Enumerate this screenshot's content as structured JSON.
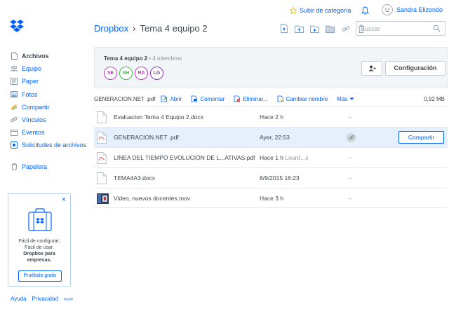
{
  "topbar": {
    "upgrade_label": "Subir de categoría",
    "user_name": "Sandra Elizondo"
  },
  "breadcrumb": {
    "root": "Dropbox",
    "separator": "›",
    "current": "Tema 4 equipo 2"
  },
  "search": {
    "placeholder": "Buscar"
  },
  "sidebar": {
    "items": [
      {
        "label": "Archivos",
        "icon": "files-icon"
      },
      {
        "label": "Equipo",
        "icon": "team-icon"
      },
      {
        "label": "Paper",
        "icon": "paper-icon"
      },
      {
        "label": "Fotos",
        "icon": "photos-icon"
      },
      {
        "label": "Compartir",
        "icon": "share-icon"
      },
      {
        "label": "Vínculos",
        "icon": "link-icon"
      },
      {
        "label": "Eventos",
        "icon": "events-icon"
      },
      {
        "label": "Solicitudes de archivos",
        "icon": "file-request-icon"
      }
    ],
    "trash_label": "Papelera"
  },
  "promo": {
    "line1": "Fácil de configurar.",
    "line2": "Fácil de usar.",
    "line3": "Dropbox para",
    "line4": "empresas.",
    "button": "Pruébalo gratis"
  },
  "footer": {
    "help": "Ayuda",
    "privacy": "Privacidad",
    "more": "«»»"
  },
  "share_panel": {
    "folder_name": "Tema 4 equipo 2",
    "meta": "• 4 miembros",
    "members": [
      {
        "initials": "SE",
        "color": "#c23ac5"
      },
      {
        "initials": "SH",
        "color": "#34c43b"
      },
      {
        "initials": "RA",
        "color": "#c23ac5"
      },
      {
        "initials": "LG",
        "color": "#8a2fc4"
      }
    ],
    "config_button": "Configuración"
  },
  "actionbar": {
    "selected_file": "GENERACION.NET .pdf",
    "open": "Abrir",
    "comment": "Comentar",
    "delete": "Eliminar...",
    "rename": "Cambiar nombre",
    "more": "Más",
    "size": "0,92 MB"
  },
  "files": [
    {
      "name": "Evaluacion Tema 4 Equipo 2.docx",
      "modified": "Hace 2 h",
      "who": "",
      "members": "--",
      "type": "doc",
      "selected": false
    },
    {
      "name": "GENERACION.NET .pdf",
      "modified": "Ayer, 22:53",
      "who": "",
      "members": "",
      "type": "pdf",
      "selected": true,
      "share_label": "Compartir"
    },
    {
      "name": "LINEA DEL TIEMPO EVOLUCIÓN DE L...ATIVAS.pdf",
      "modified": "Hace 1 h",
      "who": "Lourd...s",
      "members": "--",
      "type": "pdf",
      "selected": false
    },
    {
      "name": "TEMA4A3.docx",
      "modified": "8/9/2015 16:23",
      "who": "",
      "members": "--",
      "type": "doc",
      "selected": false
    },
    {
      "name": "Video, nuevos docentes.mov",
      "modified": "Hace 3 h",
      "who": "",
      "members": "--",
      "type": "video",
      "selected": false
    }
  ],
  "colors": {
    "accent": "#0061fe",
    "selected_row": "#e5f0fc"
  }
}
